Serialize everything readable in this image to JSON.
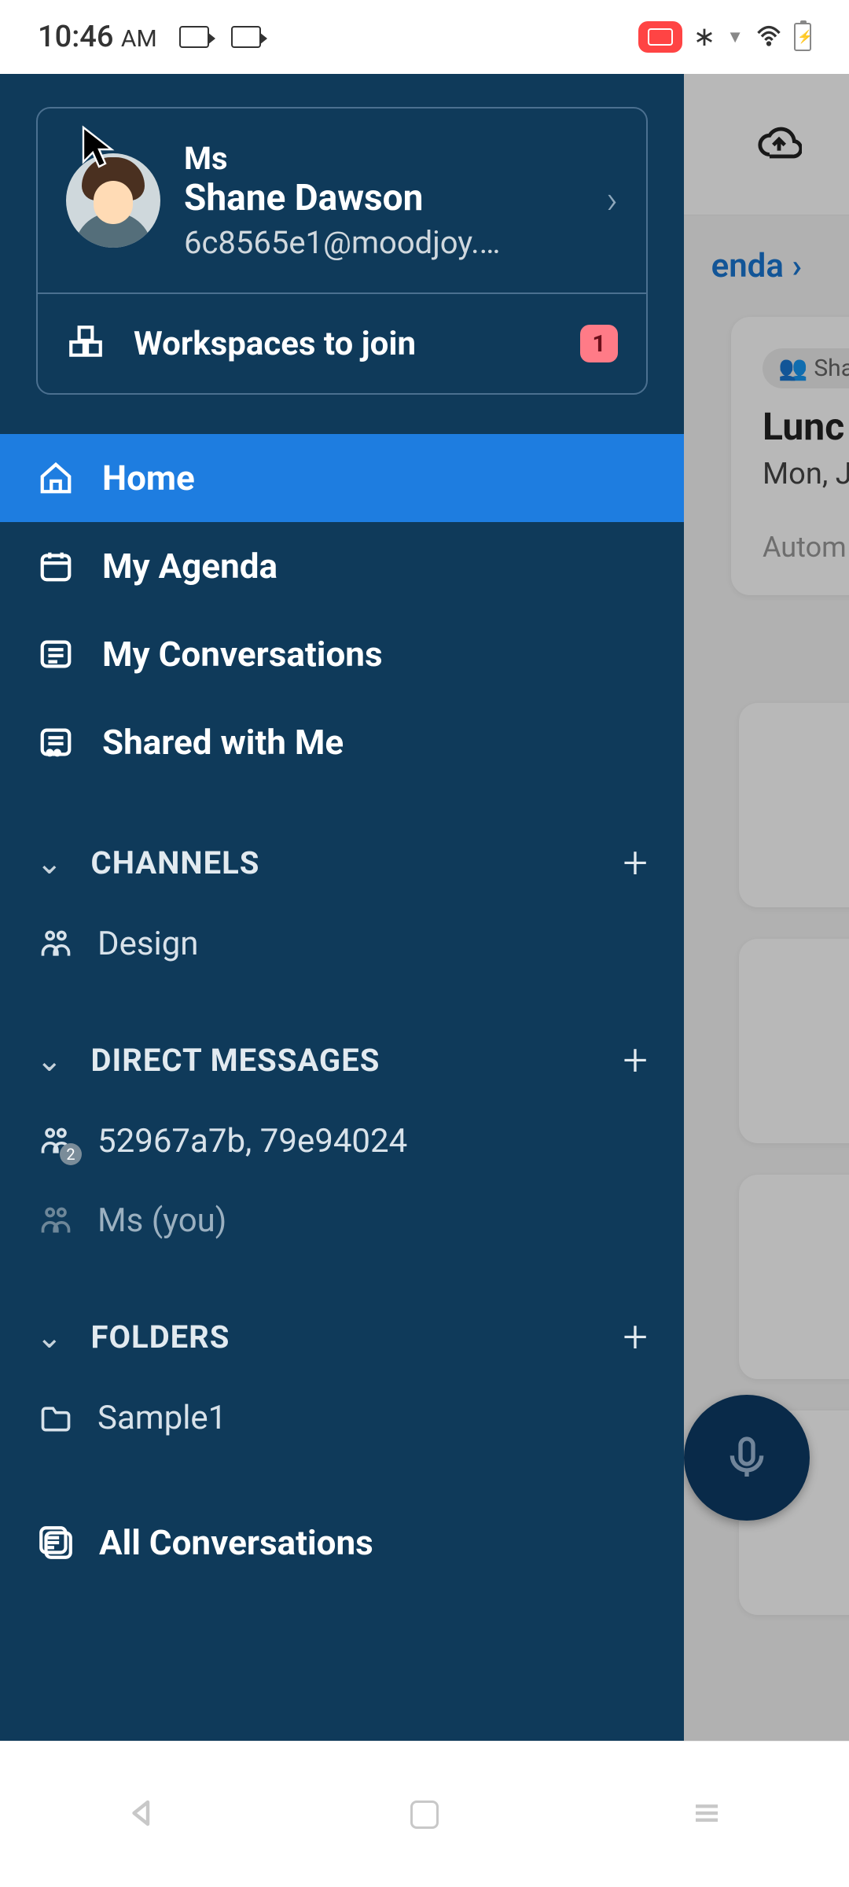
{
  "status": {
    "time": "10:46",
    "ampm": "AM"
  },
  "main": {
    "agenda_link": "enda  ›",
    "event": {
      "tag": "Sha",
      "title": "Lunc",
      "date": "Mon, J",
      "footer": "Autom"
    }
  },
  "profile": {
    "prefix": "Ms",
    "name": "Shane Dawson",
    "email": "6c8565e1@moodjoy.…"
  },
  "workspaces": {
    "label": "Workspaces to join",
    "badge": "1"
  },
  "nav": {
    "home": "Home",
    "agenda": "My Agenda",
    "conversations": "My Conversations",
    "shared": "Shared with Me"
  },
  "sections": {
    "channels": {
      "title": "CHANNELS",
      "items": [
        "Design"
      ]
    },
    "dm": {
      "title": "DIRECT MESSAGES",
      "items": [
        "52967a7b, 79e94024",
        "Ms (you)"
      ],
      "badge0": "2"
    },
    "folders": {
      "title": "FOLDERS",
      "items": [
        "Sample1"
      ]
    }
  },
  "all_conversations": "All Conversations"
}
